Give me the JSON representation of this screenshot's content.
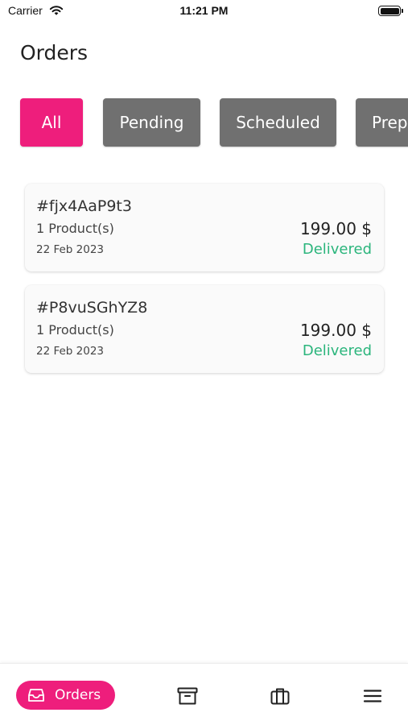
{
  "status_bar": {
    "carrier": "Carrier",
    "time": "11:21 PM",
    "icons": [
      "wifi-icon",
      "battery-icon"
    ]
  },
  "header": {
    "title": "Orders"
  },
  "tabs": [
    {
      "label": "All",
      "active": true
    },
    {
      "label": "Pending",
      "active": false
    },
    {
      "label": "Scheduled",
      "active": false
    },
    {
      "label": "Prep",
      "active": false
    }
  ],
  "orders": [
    {
      "id": "#fjx4AaP9t3",
      "products": "1 Product(s)",
      "date": "22 Feb 2023",
      "price": "199.00 $",
      "status": "Delivered"
    },
    {
      "id": "#P8vuSGhYZ8",
      "products": "1 Product(s)",
      "date": "22 Feb 2023",
      "price": "199.00 $",
      "status": "Delivered"
    }
  ],
  "bottom_nav": {
    "orders_label": "Orders",
    "items": [
      "inbox-icon",
      "archive-icon",
      "briefcase-icon",
      "menu-icon"
    ]
  },
  "colors": {
    "accent": "#ee1e7c",
    "tab_inactive": "#707070",
    "status_delivered": "#2bb57c",
    "card_background": "#fafafa"
  }
}
